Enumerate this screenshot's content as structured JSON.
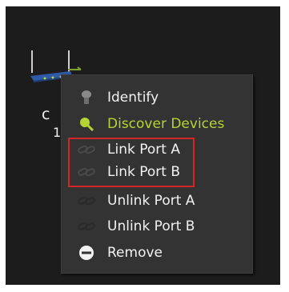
{
  "node": {
    "label_top": "c",
    "label_bottom": "1",
    "icon": "router-device-icon"
  },
  "context_menu": {
    "items": [
      {
        "label": "Identify",
        "icon": "identify-icon"
      },
      {
        "label": "Discover Devices",
        "icon": "magnifier-icon",
        "color": "#b5d334"
      },
      {
        "label": "Link Port A",
        "icon": "chain-link-icon"
      },
      {
        "label": "Link Port B",
        "icon": "chain-link-icon"
      },
      {
        "label": "Unlink Port A",
        "icon": "chain-link-icon"
      },
      {
        "label": "Unlink Port B",
        "icon": "chain-link-icon"
      },
      {
        "label": "Remove",
        "icon": "minus-circle-icon"
      }
    ],
    "highlighted": [
      "Link Port A",
      "Link Port B"
    ],
    "highlight_color": "#d42626"
  },
  "colors": {
    "background": "#1c1c1c",
    "menu_background": "#333333",
    "accent": "#b5d334"
  }
}
